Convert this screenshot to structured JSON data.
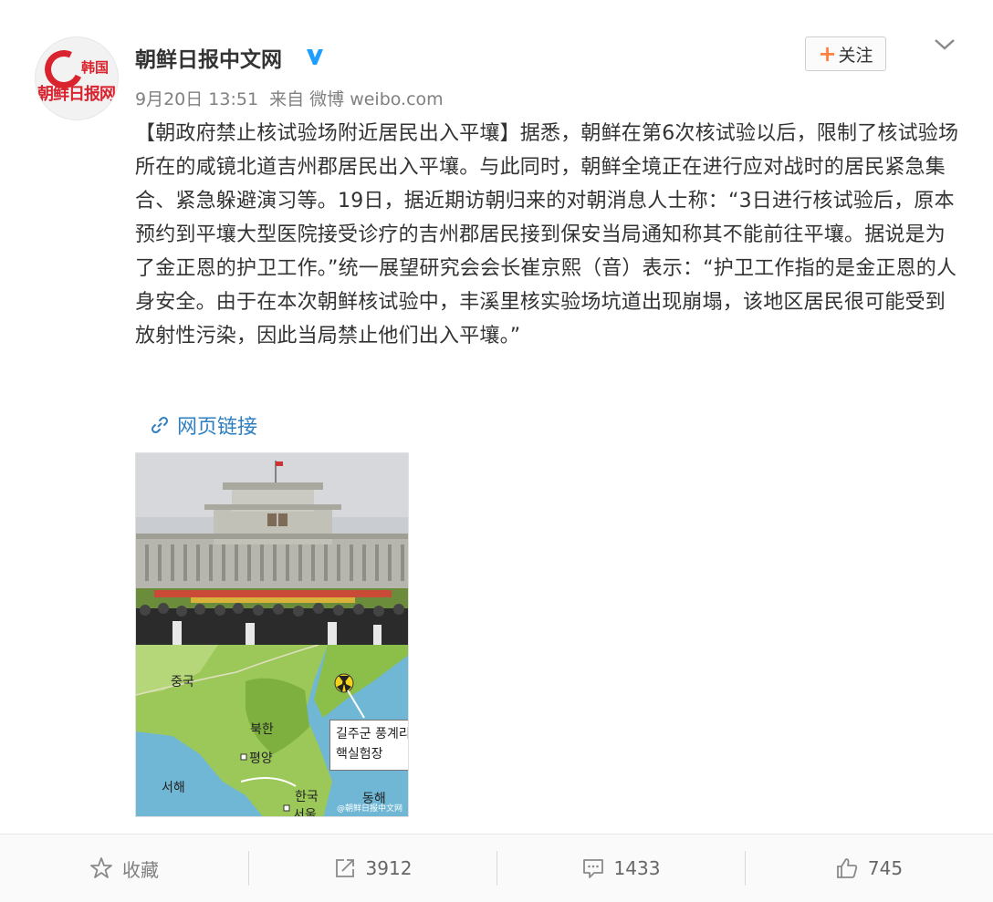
{
  "post": {
    "author": "朝鲜日报中文网",
    "avatar_text_top": "韩国",
    "avatar_text_bottom": "朝鲜日报网",
    "date": "9月20日 13:51",
    "source": "来自 微博 weibo.com",
    "follow_label": "关注",
    "text": "【朝政府禁止核试验场附近居民出入平壤】据悉，朝鲜在第6次核试验以后，限制了核试验场所在的咸镜北道吉州郡居民出入平壤。与此同时，朝鲜全境正在进行应对战时的居民紧急集合、紧急躲避演习等。19日，据近期访朝归来的对朝消息人士称：“3日进行核试验后，原本预约到平壤大型医院接受诊疗的吉州郡居民接到保安当局通知称其不能前往平壤。据说是为了金正恩的护卫工作。”统一展望研究会会长崔京熙（音）表示：“护卫工作指的是金正恩的人身安全。由于在本次朝鲜核试验中，丰溪里核实验场坑道出现崩塌，该地区居民很可能受到放射性污染，因此当局禁止他们出入平壤。”",
    "link_label": "网页链接"
  },
  "image": {
    "map_labels": {
      "china": "중국",
      "north_korea": "북한",
      "pyongyang": "평양",
      "west_sea": "서해",
      "south_korea": "한국",
      "seoul": "서울",
      "east_sea": "동해"
    },
    "callout_line1": "길주군 풍계리",
    "callout_line2": "핵실험장",
    "watermark": "@朝鲜日报中文网"
  },
  "actions": {
    "favorite_label": "收藏",
    "repost_count": "3912",
    "comment_count": "1433",
    "like_count": "745"
  },
  "colors": {
    "link": "#2e7fc1",
    "follow_plus": "#ff8140",
    "verified": "#1e9fff",
    "brand_red": "#d9232e"
  }
}
